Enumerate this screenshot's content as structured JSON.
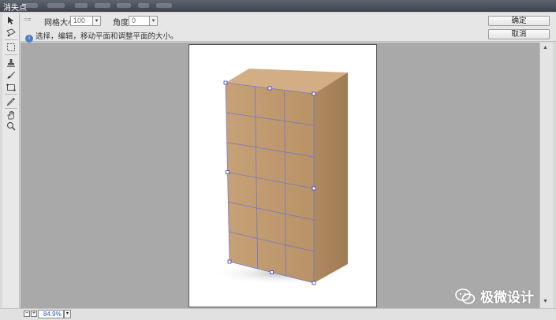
{
  "window": {
    "title": "消失点"
  },
  "options": {
    "grid_label": "网格大小:",
    "grid_value": "100",
    "angle_label": "角度:",
    "angle_value": "0",
    "hint": "选择，编辑，移动平面和调整平面的大小。",
    "ok_label": "确定",
    "cancel_label": "取消"
  },
  "tools": [
    "edit-plane-tool",
    "create-plane-tool",
    "marquee-tool",
    "stamp-tool",
    "brush-tool",
    "transform-tool",
    "eyedropper-tool",
    "measure-tool",
    "hand-tool",
    "zoom-tool"
  ],
  "status": {
    "zoom": "84.9%"
  },
  "watermark": {
    "text": "极微设计"
  },
  "colors": {
    "grid_line": "#6b6fd8",
    "box_front": "#c49b6b",
    "box_side": "#a9825a",
    "box_top": "#d2ac80"
  }
}
